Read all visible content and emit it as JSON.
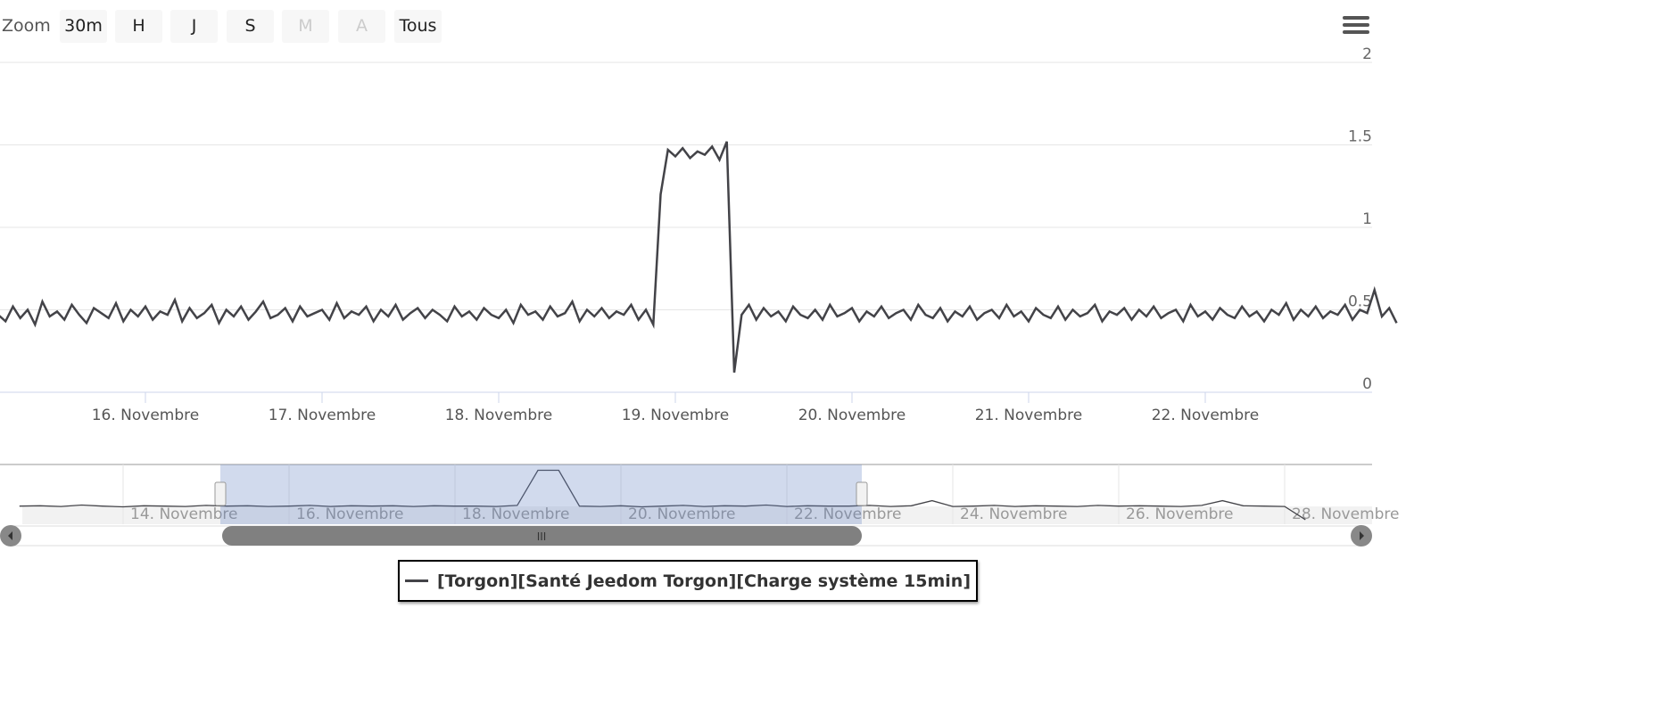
{
  "range_selector": {
    "label": "Zoom",
    "buttons": [
      {
        "label": "30m",
        "enabled": true
      },
      {
        "label": "H",
        "enabled": true
      },
      {
        "label": "J",
        "enabled": true
      },
      {
        "label": "S",
        "enabled": true
      },
      {
        "label": "M",
        "enabled": false
      },
      {
        "label": "A",
        "enabled": false
      },
      {
        "label": "Tous",
        "enabled": true
      }
    ]
  },
  "menu_icon": "hamburger-menu-icon",
  "chart_data": {
    "type": "line",
    "series": [
      {
        "name": "[Torgon][Santé Jeedom Torgon][Charge système 15min]",
        "color": "#434348",
        "x_start": "15 Novembre 04:00",
        "interval_minutes": 60,
        "values": [
          0.47,
          0.43,
          0.52,
          0.45,
          0.5,
          0.41,
          0.55,
          0.46,
          0.49,
          0.44,
          0.53,
          0.47,
          0.42,
          0.51,
          0.48,
          0.45,
          0.54,
          0.43,
          0.5,
          0.46,
          0.52,
          0.44,
          0.49,
          0.47,
          0.56,
          0.43,
          0.51,
          0.45,
          0.48,
          0.53,
          0.42,
          0.5,
          0.46,
          0.52,
          0.44,
          0.49,
          0.55,
          0.45,
          0.47,
          0.51,
          0.43,
          0.52,
          0.46,
          0.48,
          0.5,
          0.44,
          0.54,
          0.45,
          0.49,
          0.47,
          0.52,
          0.43,
          0.5,
          0.46,
          0.53,
          0.44,
          0.48,
          0.51,
          0.45,
          0.5,
          0.47,
          0.43,
          0.52,
          0.46,
          0.49,
          0.44,
          0.51,
          0.47,
          0.45,
          0.5,
          0.42,
          0.53,
          0.47,
          0.49,
          0.44,
          0.52,
          0.46,
          0.48,
          0.55,
          0.43,
          0.5,
          0.46,
          0.51,
          0.45,
          0.49,
          0.47,
          0.53,
          0.44,
          0.5,
          0.41,
          1.2,
          1.47,
          1.43,
          1.48,
          1.42,
          1.46,
          1.44,
          1.49,
          1.41,
          1.52,
          0.12,
          0.47,
          0.53,
          0.44,
          0.51,
          0.46,
          0.49,
          0.43,
          0.52,
          0.47,
          0.45,
          0.5,
          0.44,
          0.53,
          0.46,
          0.48,
          0.51,
          0.43,
          0.49,
          0.46,
          0.52,
          0.45,
          0.48,
          0.5,
          0.44,
          0.53,
          0.47,
          0.45,
          0.51,
          0.43,
          0.49,
          0.46,
          0.52,
          0.44,
          0.48,
          0.5,
          0.45,
          0.53,
          0.46,
          0.49,
          0.43,
          0.51,
          0.47,
          0.45,
          0.52,
          0.44,
          0.5,
          0.46,
          0.48,
          0.53,
          0.43,
          0.49,
          0.47,
          0.51,
          0.44,
          0.5,
          0.46,
          0.52,
          0.45,
          0.48,
          0.5,
          0.43,
          0.53,
          0.46,
          0.49,
          0.44,
          0.51,
          0.47,
          0.45,
          0.52,
          0.46,
          0.49,
          0.43,
          0.5,
          0.47,
          0.54,
          0.44,
          0.5,
          0.46,
          0.52,
          0.45,
          0.49,
          0.47,
          0.53,
          0.44,
          0.5,
          0.48,
          0.62,
          0.46,
          0.51,
          0.42
        ]
      }
    ],
    "yaxis": {
      "ticks": [
        "0",
        "0.5",
        "1",
        "1.5",
        "2"
      ],
      "ylim": [
        0,
        2
      ],
      "position": "right",
      "grid": true
    },
    "xaxis": {
      "ticks": [
        "16. Novembre",
        "17. Novembre",
        "18. Novembre",
        "19. Novembre",
        "20. Novembre",
        "21. Novembre",
        "22. Novembre"
      ]
    },
    "navigator": {
      "x_start": "12 Novembre 18:00",
      "interval_minutes": 360,
      "values": [
        0.47,
        0.48,
        0.46,
        0.5,
        0.47,
        0.45,
        0.48,
        0.47,
        0.46,
        0.49,
        0.47,
        0.48,
        0.46,
        0.47,
        0.49,
        0.46,
        0.48,
        0.47,
        0.48,
        0.46,
        0.48,
        0.47,
        0.47,
        0.46,
        0.49,
        1.45,
        1.45,
        0.47,
        0.46,
        0.48,
        0.45,
        0.47,
        0.49,
        0.46,
        0.48,
        0.47,
        0.5,
        0.46,
        0.48,
        0.47,
        0.47,
        0.49,
        0.46,
        0.48,
        0.62,
        0.46,
        0.47,
        0.49,
        0.46,
        0.48,
        0.47,
        0.46,
        0.49,
        0.47,
        0.48,
        0.47,
        0.46,
        0.49,
        0.62,
        0.48,
        0.47,
        0.46,
        0.1
      ],
      "ticks": [
        "14. Novembre",
        "16. Novembre",
        "18. Novembre",
        "20. Novembre",
        "22. Novembre",
        "24. Novembre",
        "26. Novembre",
        "28. Novembre"
      ],
      "selected_range": [
        "15 Novembre 04:00",
        "22 Novembre 22:00"
      ]
    },
    "legend": {
      "position": "bottom-center"
    }
  }
}
